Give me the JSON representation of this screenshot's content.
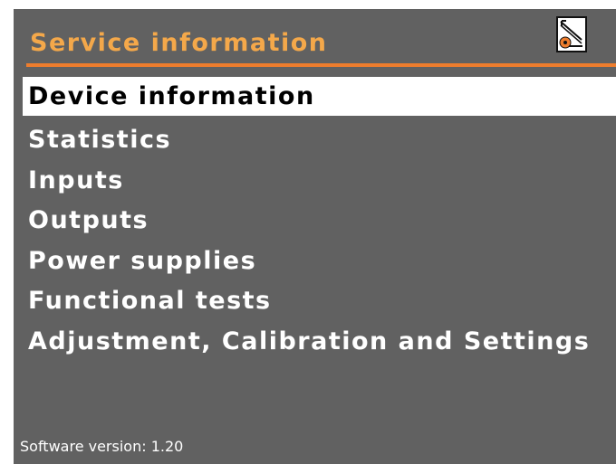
{
  "header": {
    "title": "Service information",
    "icon": "service-tool-icon"
  },
  "menu": {
    "selected_index": 0,
    "items": [
      {
        "label": "Device information"
      },
      {
        "label": "Statistics"
      },
      {
        "label": "Inputs"
      },
      {
        "label": "Outputs"
      },
      {
        "label": "Power supplies"
      },
      {
        "label": "Functional tests"
      },
      {
        "label": "Adjustment, Calibration and Settings"
      }
    ]
  },
  "footer": {
    "software_version": "Software version: 1.20"
  },
  "colors": {
    "background": "#616161",
    "title": "#f4a84a",
    "rule": "#ee7d2d",
    "text": "#ffffff",
    "selected_bg": "#ffffff",
    "selected_text": "#000000"
  }
}
